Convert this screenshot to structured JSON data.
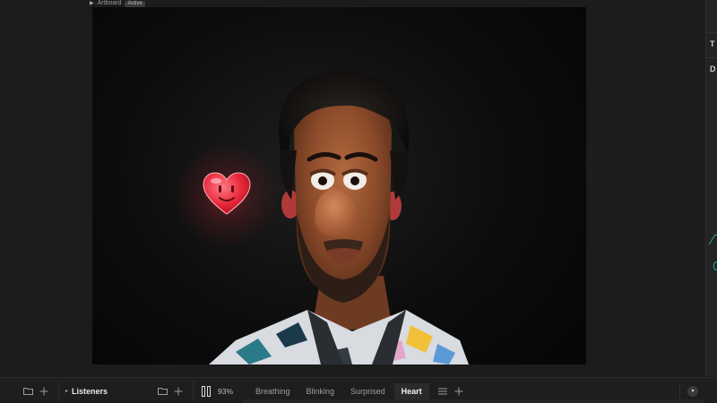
{
  "artboard": {
    "name": "Artboard",
    "badge": "Active"
  },
  "right_panel": {
    "tab_1": "T",
    "tab_2": "D"
  },
  "listeners": {
    "label": "Listeners"
  },
  "playback": {
    "zoom": "93%"
  },
  "animations": {
    "tabs": [
      {
        "label": "Breathing",
        "active": false
      },
      {
        "label": "Blinking",
        "active": false
      },
      {
        "label": "Surprised",
        "active": false
      },
      {
        "label": "Heart",
        "active": true
      }
    ]
  },
  "colors": {
    "background": "#1c1c1c",
    "accent_teal": "#33aaaa",
    "heart_red": "#e8283a"
  },
  "icons": [
    "play-icon",
    "folder-icon",
    "plus-icon",
    "caret-right-icon",
    "pause-icon",
    "list-icon",
    "chevron-down-icon"
  ]
}
